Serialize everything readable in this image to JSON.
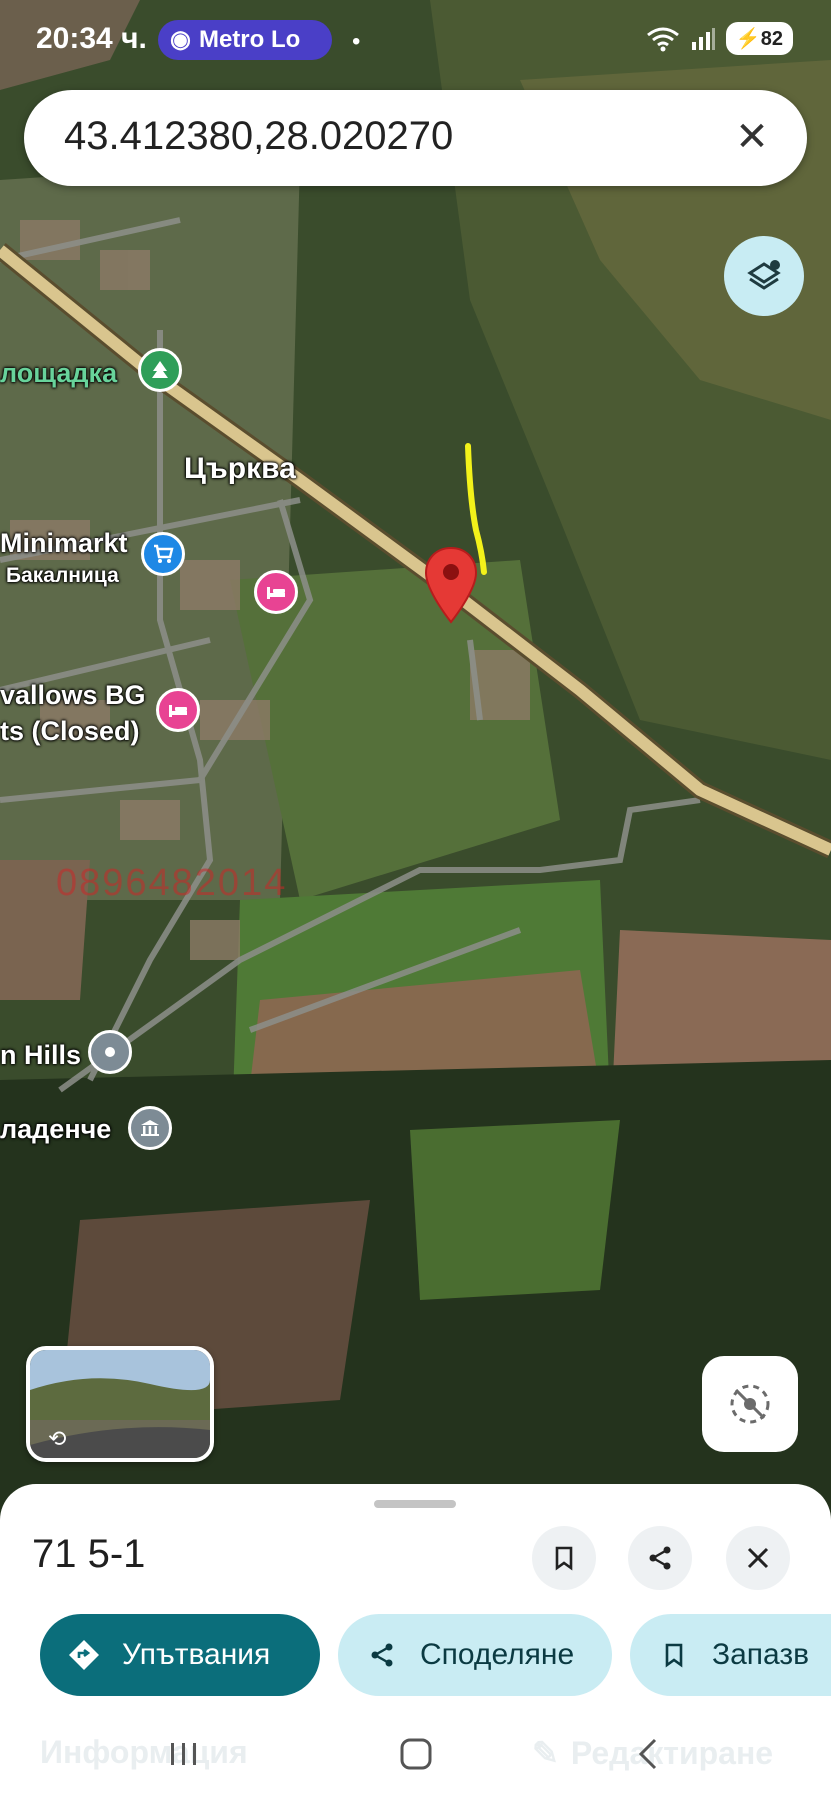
{
  "status_bar": {
    "time": "20:34 ч.",
    "notification_pill": "Metro Lo",
    "battery": "82"
  },
  "search": {
    "query": "43.412380,28.020270"
  },
  "map_labels": {
    "park": "лощадка",
    "church": "Църква",
    "market": "Minimarkt",
    "market_sub": "Бакалница",
    "hotel_line1": "vallows BG",
    "hotel_line2": "ts (Closed)",
    "hills": "n Hills",
    "spring": "ладенче",
    "watermark_phone": "0896482014"
  },
  "place_sheet": {
    "title": "71 5-1",
    "actions": {
      "directions": "Упътвания",
      "share": "Споделяне",
      "save": "Запазв"
    },
    "tabs": {
      "info": "Информация",
      "edit": "Редактиране"
    }
  },
  "colors": {
    "primary": "#0b6e7b",
    "secondary_bg": "#c9ecf3",
    "pin": "#e53935",
    "road": "#d9c58e"
  }
}
